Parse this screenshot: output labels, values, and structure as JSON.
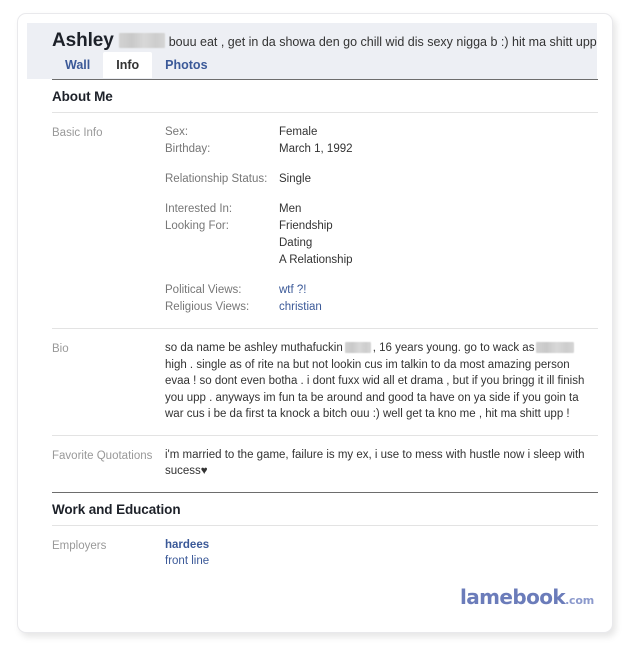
{
  "profile": {
    "name": "Ashley",
    "name_redacted": true,
    "status": "bouu eat , get in da showa den go chill wid dis sexy nigga b :) hit ma shitt uppp !"
  },
  "tabs": [
    {
      "label": "Wall",
      "active": false
    },
    {
      "label": "Info",
      "active": true
    },
    {
      "label": "Photos",
      "active": false
    }
  ],
  "sections": {
    "about_me": {
      "heading": "About Me",
      "basic_info": {
        "label": "Basic Info",
        "groups": [
          {
            "pairs": [
              {
                "key": "Sex:",
                "value": "Female"
              },
              {
                "key": "Birthday:",
                "value": "March 1, 1992"
              }
            ]
          },
          {
            "pairs": [
              {
                "key": "Relationship Status:",
                "value": "Single"
              }
            ]
          },
          {
            "pairs": [
              {
                "key": "Interested In:",
                "value": "Men"
              },
              {
                "key": "Looking For:",
                "value": "Friendship"
              }
            ],
            "extra_values": [
              "Dating",
              "A Relationship"
            ]
          },
          {
            "pairs": [
              {
                "key": "Political Views:",
                "value": "wtf ?!",
                "link": true
              },
              {
                "key": "Religious Views:",
                "value": "christian",
                "link": true
              }
            ]
          }
        ]
      },
      "bio": {
        "label": "Bio",
        "text_part_1": "so da name be ashley muthafuckin",
        "text_part_2": ", 16 years young. go to wack as",
        "text_part_3": "high . single as of rite na but not lookin cus im talkin to da most amazing person evaa ! so dont even botha . i dont fuxx wid all et drama , but if you bringg it ill finish you upp . anyways im fun ta be around and good ta have on ya side if you goin ta war cus i be da first ta knock a bitch ouu :) well get ta kno me , hit ma shitt upp !"
      },
      "favorite_quotations": {
        "label": "Favorite Quotations",
        "text": "i'm married to the game, failure is my ex, i use to mess with hustle now i sleep with sucess",
        "heart": "♥"
      }
    },
    "work_and_education": {
      "heading": "Work and Education",
      "employers": {
        "label": "Employers",
        "name": "hardees",
        "role": "front line"
      }
    }
  },
  "watermark": {
    "main": "lamebook",
    "tld": ".com"
  },
  "colors": {
    "header_band": "#edeff4",
    "link": "#3b5998",
    "label_grey": "#999999",
    "text": "#333333",
    "watermark": "#6b7cba"
  }
}
